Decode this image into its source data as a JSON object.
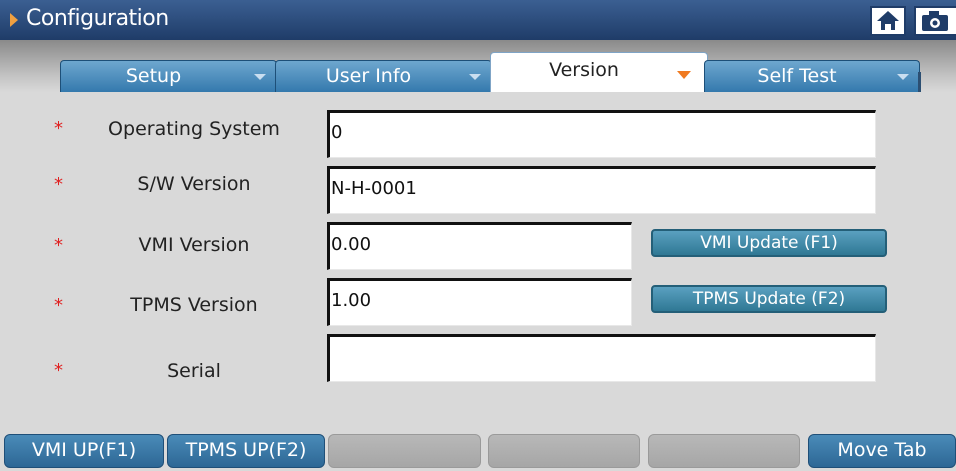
{
  "window": {
    "title": "Configuration"
  },
  "tabs": [
    {
      "label": "Setup"
    },
    {
      "label": "User Info"
    },
    {
      "label": "Version",
      "active": true
    },
    {
      "label": "Self Test"
    }
  ],
  "form": {
    "required_marker": "*",
    "rows": [
      {
        "label": "Operating System",
        "value": "0"
      },
      {
        "label": "S/W Version",
        "value": "N-H-0001"
      },
      {
        "label": "VMI Version",
        "value": "0.00",
        "action": "VMI Update (F1)"
      },
      {
        "label": "TPMS Version",
        "value": "1.00",
        "action": "TPMS Update (F2)"
      },
      {
        "label": "Serial",
        "value": ""
      }
    ]
  },
  "function_keys": [
    "VMI UP(F1)",
    "TPMS UP(F2)",
    "",
    "",
    "",
    "Move Tab"
  ],
  "colors": {
    "title_bar": "#1f3c68",
    "tab": "#3479ad",
    "action_button": "#2f7894",
    "required_marker": "#e02020"
  }
}
